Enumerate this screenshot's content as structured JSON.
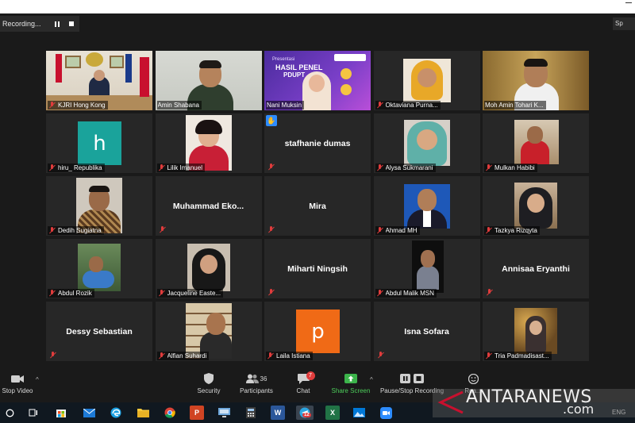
{
  "recording": {
    "label": "Recording..."
  },
  "top_right_text": "Sp",
  "tiles": [
    {
      "name": "KJRI Hong Kong",
      "muted": true,
      "type": "video",
      "scene": "office"
    },
    {
      "name": "Amin Shabana",
      "muted": false,
      "type": "video",
      "scene": "man-green",
      "active": true
    },
    {
      "name": "Nani Muksin",
      "muted": false,
      "type": "video",
      "scene": "poster",
      "poster_title": "HASIL PENEL",
      "poster_sub": "PDUPT"
    },
    {
      "name": "Oktaviana Purna...",
      "muted": true,
      "type": "video",
      "scene": "woman-hijab-yellow"
    },
    {
      "name": "Moh Amin Tohari K...",
      "muted": false,
      "type": "video",
      "scene": "man-gold"
    },
    {
      "name": "hiru_ Republika",
      "muted": true,
      "type": "avatar",
      "letter": "h",
      "color": "#1aa39b"
    },
    {
      "name": "Lilik Imanuel",
      "muted": true,
      "type": "video",
      "scene": "woman-red"
    },
    {
      "name": "stafhanie dumas",
      "muted": true,
      "type": "name",
      "raise_hand": true
    },
    {
      "name": "Alysa Sukmarani",
      "muted": true,
      "type": "video",
      "scene": "woman-teal"
    },
    {
      "name": "Mulkan Habibi",
      "muted": true,
      "type": "video",
      "scene": "man-room"
    },
    {
      "name": "Dedih Sugiatna",
      "muted": true,
      "type": "video",
      "scene": "man-batik"
    },
    {
      "name": "Muhammad  Eko...",
      "muted": true,
      "type": "name"
    },
    {
      "name": "Mira",
      "muted": true,
      "type": "name"
    },
    {
      "name": "Ahmad MH",
      "muted": true,
      "type": "video",
      "scene": "man-blue"
    },
    {
      "name": "Tazkya Rizqyta",
      "muted": true,
      "type": "video",
      "scene": "woman-dark"
    },
    {
      "name": "Abdul Rozik",
      "muted": true,
      "type": "video",
      "scene": "man-outdoor"
    },
    {
      "name": "Jacqueline Easte...",
      "muted": true,
      "type": "video",
      "scene": "woman-black"
    },
    {
      "name": "Miharti Ningsih",
      "muted": true,
      "type": "name"
    },
    {
      "name": "Abdul Malik MSN",
      "muted": true,
      "type": "video",
      "scene": "man-dark"
    },
    {
      "name": "Annisaa Eryanthi",
      "muted": true,
      "type": "name"
    },
    {
      "name": "Dessy Sebastian",
      "muted": true,
      "type": "name"
    },
    {
      "name": "Alfian Suhardi",
      "muted": true,
      "type": "video",
      "scene": "man-shelf"
    },
    {
      "name": "Laila Istiana",
      "muted": true,
      "type": "avatar",
      "letter": "p",
      "color": "#f06a16"
    },
    {
      "name": "Isna Sofara",
      "muted": true,
      "type": "name"
    },
    {
      "name": "Tria Padmadisast...",
      "muted": true,
      "type": "video",
      "scene": "woman-bokeh"
    }
  ],
  "toolbar": {
    "stop_video": "Stop Video",
    "security": "Security",
    "participants": "Participants",
    "participants_count": "36",
    "chat": "Chat",
    "chat_badge": "7",
    "share_screen": "Share Screen",
    "pause_stop_recording": "Pause/Stop Recording",
    "reactions": "Rea..."
  },
  "taskbar": {
    "language": "ENG",
    "telegram_badge": "12",
    "apps": [
      "start",
      "task-view",
      "store",
      "mail",
      "edge",
      "explorer",
      "chrome",
      "powerpoint",
      "remote",
      "calculator",
      "word",
      "telegram",
      "excel",
      "photos",
      "zoom"
    ]
  },
  "watermark": {
    "brand": "ANTARANEWS",
    "suffix": ".com"
  },
  "colors": {
    "active_border": "#c9e04a",
    "muted_red": "#e03c3c",
    "share_green": "#4ccc5a",
    "tile_bg": "#272727"
  }
}
